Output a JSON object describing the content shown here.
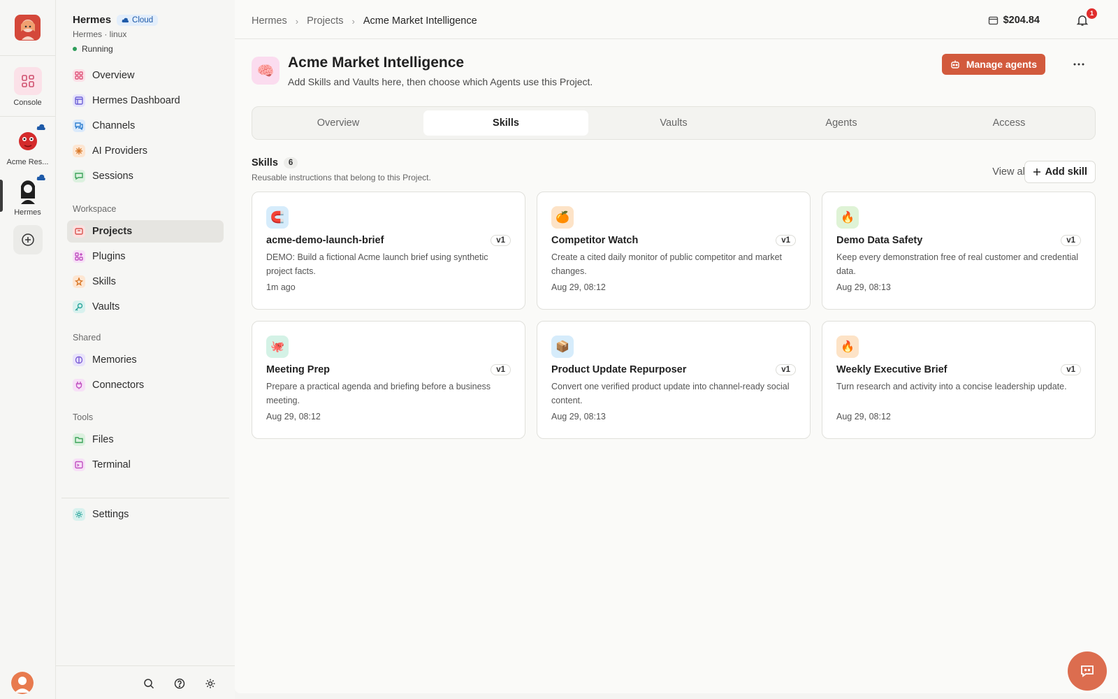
{
  "rail": {
    "items": [
      {
        "label": "Console"
      },
      {
        "label": "Acme Res..."
      },
      {
        "label": "Hermes"
      }
    ]
  },
  "sidebar": {
    "title": "Hermes",
    "badge": "Cloud",
    "subtitle": "Hermes · linux",
    "status": "Running",
    "main_items": [
      {
        "label": "Overview",
        "icon": "grid-icon",
        "color": "#e0557a"
      },
      {
        "label": "Hermes Dashboard",
        "icon": "dashboard-icon",
        "color": "#6b5fd6"
      },
      {
        "label": "Channels",
        "icon": "chat-icon",
        "color": "#2f7fd0"
      },
      {
        "label": "AI Providers",
        "icon": "sparkle-icon",
        "color": "#d97a2b"
      },
      {
        "label": "Sessions",
        "icon": "message-icon",
        "color": "#3da35a"
      }
    ],
    "workspace_label": "Workspace",
    "workspace_items": [
      {
        "label": "Projects",
        "icon": "folder-icon",
        "color": "#d9534f"
      },
      {
        "label": "Plugins",
        "icon": "plugin-icon",
        "color": "#c04fc0"
      },
      {
        "label": "Skills",
        "icon": "skills-icon",
        "color": "#d97a2b"
      },
      {
        "label": "Vaults",
        "icon": "key-icon",
        "color": "#2aa59b"
      }
    ],
    "shared_label": "Shared",
    "shared_items": [
      {
        "label": "Memories",
        "icon": "brain-icon",
        "color": "#7d5fd6"
      },
      {
        "label": "Connectors",
        "icon": "plug-icon",
        "color": "#c04fc0"
      }
    ],
    "tools_label": "Tools",
    "tools_items": [
      {
        "label": "Files",
        "icon": "folder-open-icon",
        "color": "#3da35a"
      },
      {
        "label": "Terminal",
        "icon": "terminal-icon",
        "color": "#c04fc0"
      }
    ],
    "settings_label": "Settings"
  },
  "topbar": {
    "breadcrumbs": [
      "Hermes",
      "Projects",
      "Acme Market Intelligence"
    ],
    "balance": "$204.84",
    "notifications": "1"
  },
  "project": {
    "title": "Acme Market Intelligence",
    "description": "Add Skills and Vaults here, then choose which Agents use this Project.",
    "manage_label": "Manage agents",
    "icon": "brain-icon"
  },
  "tabs": [
    "Overview",
    "Skills",
    "Vaults",
    "Agents",
    "Access"
  ],
  "active_tab": "Skills",
  "skills": {
    "title": "Skills",
    "count": "6",
    "subtitle": "Reusable instructions that belong to this Project.",
    "view_all": "View all",
    "add_label": "Add skill",
    "items": [
      {
        "name": "acme-demo-launch-brief",
        "version": "v1",
        "desc": "DEMO: Build a fictional Acme launch brief using synthetic project facts.",
        "time": "1m ago",
        "emoji": "🧲",
        "bg": "#d6ecfb"
      },
      {
        "name": "Competitor Watch",
        "version": "v1",
        "desc": "Create a cited daily monitor of public competitor and market changes.",
        "time": "Aug 29, 08:12",
        "emoji": "🍊",
        "bg": "#fde3c7"
      },
      {
        "name": "Demo Data Safety",
        "version": "v1",
        "desc": "Keep every demonstration free of real customer and credential data.",
        "time": "Aug 29, 08:13",
        "emoji": "🔥",
        "bg": "#dff3d6"
      },
      {
        "name": "Meeting Prep",
        "version": "v1",
        "desc": "Prepare a practical agenda and briefing before a business meeting.",
        "time": "Aug 29, 08:12",
        "emoji": "🐙",
        "bg": "#d4f2e6"
      },
      {
        "name": "Product Update Repurposer",
        "version": "v1",
        "desc": "Convert one verified product update into channel-ready social content.",
        "time": "Aug 29, 08:13",
        "emoji": "📦",
        "bg": "#d6ecfb"
      },
      {
        "name": "Weekly Executive Brief",
        "version": "v1",
        "desc": "Turn research and activity into a concise leadership update.",
        "time": "Aug 29, 08:12",
        "emoji": "🔥",
        "bg": "#fde3c7"
      }
    ]
  },
  "colors": {
    "accent": "#d25a3d",
    "fab": "#dc6d4f",
    "status_green": "#2f9e5b",
    "badge_red": "#e02d2d"
  }
}
